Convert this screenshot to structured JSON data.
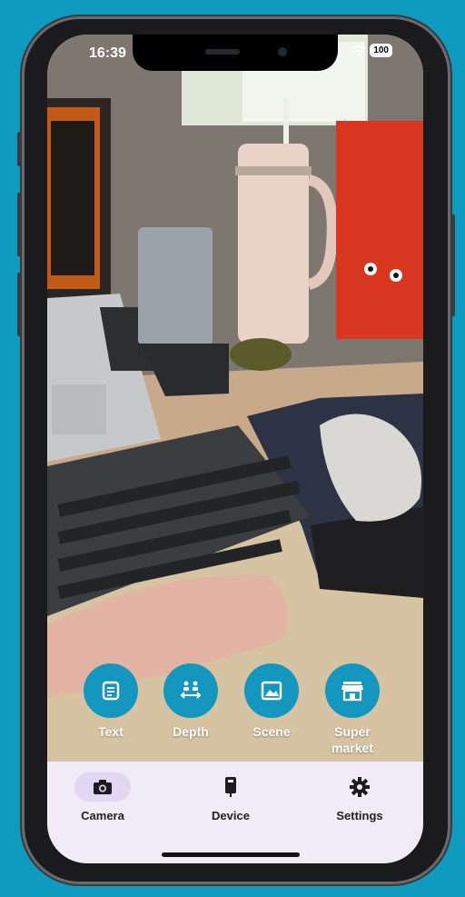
{
  "status_bar": {
    "time": "16:39",
    "battery": "100"
  },
  "modes": [
    {
      "label": "Text",
      "icon": "document-icon"
    },
    {
      "label": "Depth",
      "icon": "depth-icon"
    },
    {
      "label": "Scene",
      "icon": "image-icon"
    },
    {
      "label": "Super\nmarket",
      "icon": "storefront-icon"
    }
  ],
  "tabs": [
    {
      "label": "Camera",
      "icon": "camera-icon",
      "active": true
    },
    {
      "label": "Device",
      "icon": "device-icon",
      "active": false
    },
    {
      "label": "Settings",
      "icon": "gear-icon",
      "active": false
    }
  ],
  "colors": {
    "accent": "#1497bf",
    "tabbar_bg": "#f1ebf7",
    "active_tab_pill": "#e2d7f3",
    "frame_bg": "#0f9ac0"
  }
}
